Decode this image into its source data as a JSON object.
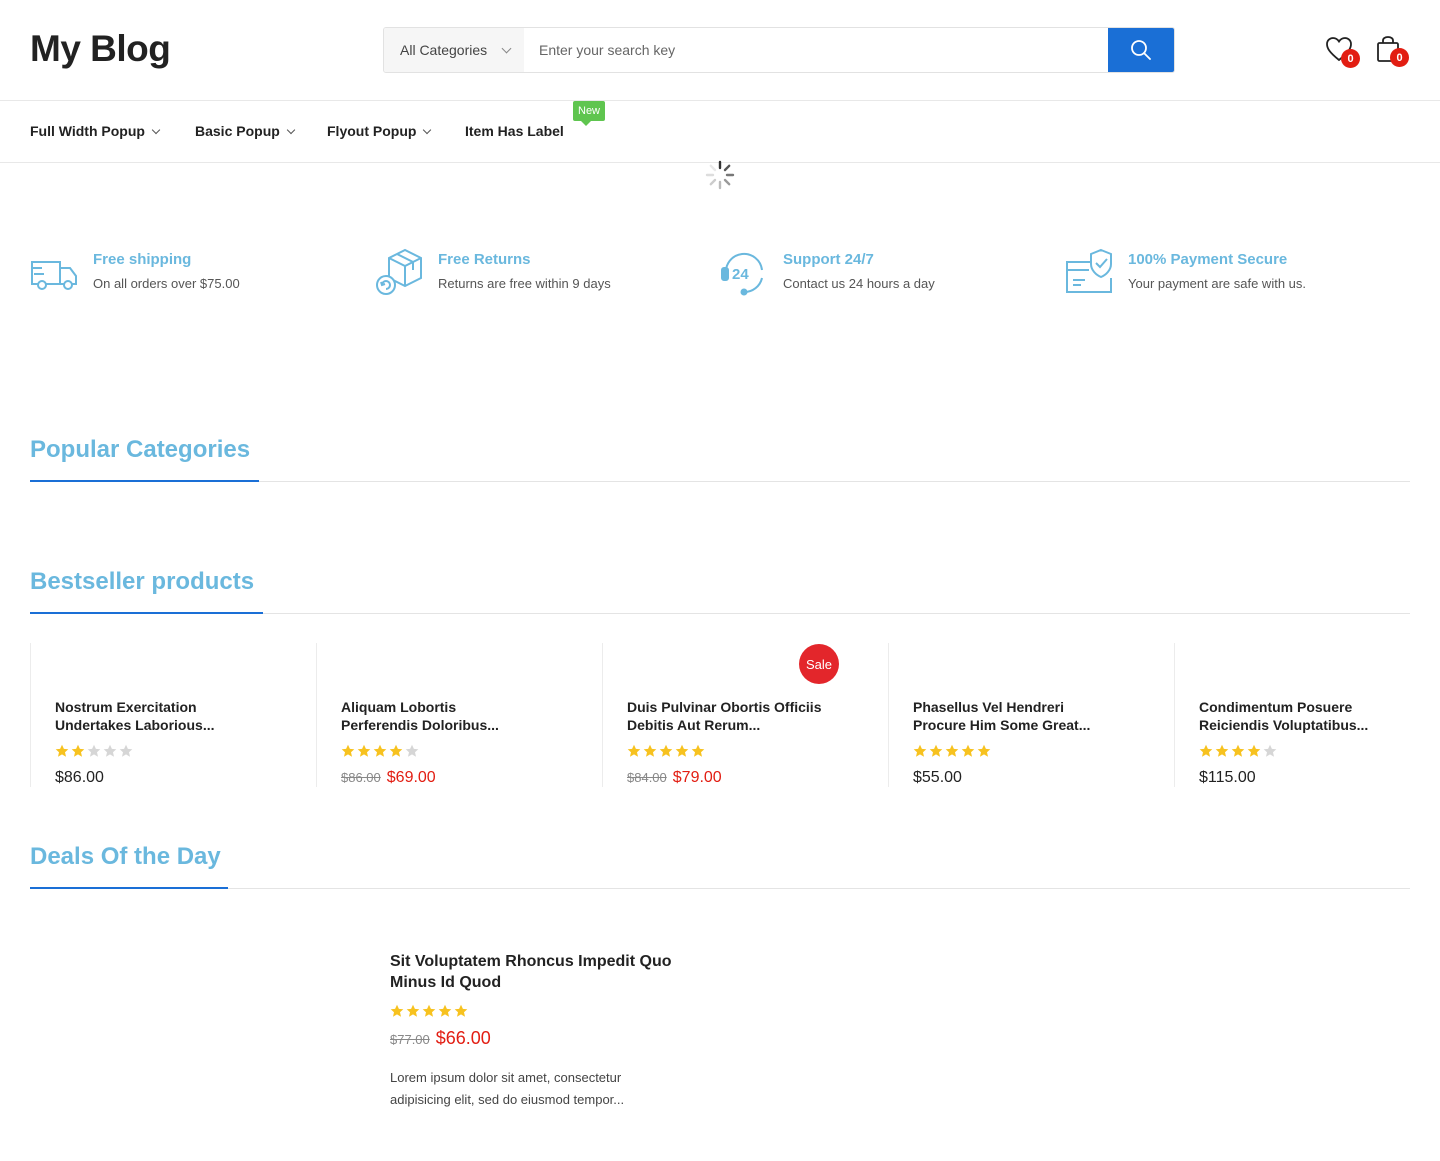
{
  "header": {
    "logo": "My Blog",
    "search": {
      "category": "All Categories",
      "placeholder": "Enter your search key"
    },
    "wishlist_count": "0",
    "cart_count": "0"
  },
  "nav": {
    "items": [
      {
        "label": "Full Width Popup"
      },
      {
        "label": "Basic Popup"
      },
      {
        "label": "Flyout Popup"
      },
      {
        "label": "Item Has Label"
      }
    ],
    "new_label": "New"
  },
  "features": [
    {
      "icon": "truck-icon",
      "title": "Free shipping",
      "subtitle": "On all orders over $75.00"
    },
    {
      "icon": "return-box-icon",
      "title": "Free Returns",
      "subtitle": "Returns are free within 9 days"
    },
    {
      "icon": "support-24-icon",
      "title": "Support 24/7",
      "subtitle": "Contact us 24 hours a day"
    },
    {
      "icon": "secure-payment-icon",
      "title": "100% Payment Secure",
      "subtitle": "Your payment are safe with us."
    }
  ],
  "sections": {
    "popular": "Popular Categories",
    "bestseller": "Bestseller products",
    "deals": "Deals Of the Day"
  },
  "products": [
    {
      "line1": "Nostrum Exercitation",
      "line2": "Undertakes Laborious...",
      "rating": 2,
      "old_price": "",
      "price": "$86.00",
      "sale": false
    },
    {
      "line1": "Aliquam Lobortis",
      "line2": "Perferendis Doloribus...",
      "rating": 4,
      "old_price": "$86.00",
      "price": "$69.00",
      "sale": false
    },
    {
      "line1": "Duis Pulvinar Obortis Officiis",
      "line2": "Debitis Aut Rerum...",
      "rating": 5,
      "old_price": "$84.00",
      "price": "$79.00",
      "sale": true
    },
    {
      "line1": "Phasellus Vel Hendreri",
      "line2": "Procure Him Some Great...",
      "rating": 5,
      "old_price": "",
      "price": "$55.00",
      "sale": false
    },
    {
      "line1": "Condimentum Posuere",
      "line2": "Reiciendis Voluptatibus...",
      "rating": 4,
      "old_price": "",
      "price": "$115.00",
      "sale": false
    }
  ],
  "sale_label": "Sale",
  "deal": {
    "line1": "Sit Voluptatem Rhoncus Impedit Quo",
    "line2": "Minus Id Quod",
    "rating": 5,
    "old_price": "$77.00",
    "price": "$66.00",
    "desc_line1": "Lorem ipsum dolor sit amet, consectetur",
    "desc_line2": "adipisicing elit, sed do eiusmod tempor..."
  },
  "colors": {
    "accent": "#1a6fd6",
    "section_title": "#6ab8de",
    "badge": "#e21d12",
    "star_on": "#f7c21f",
    "star_off": "#d6d6d6",
    "new_label": "#5fc54f"
  }
}
